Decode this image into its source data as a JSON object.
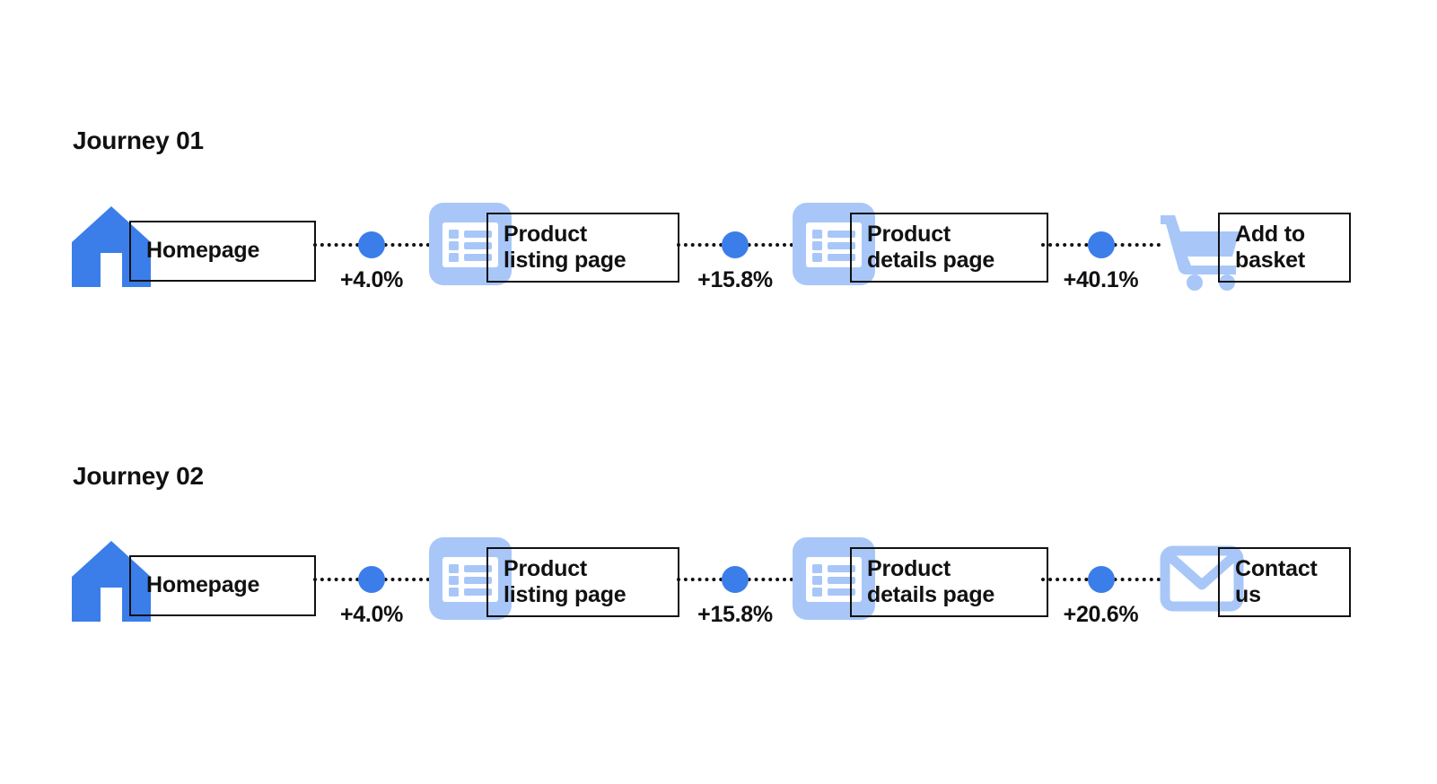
{
  "colors": {
    "icon_primary": "#3B7EEA",
    "icon_secondary": "#A8C7F8",
    "dot": "#3B7EEA",
    "text": "#111111",
    "background": "#FFFFFF",
    "box_border": "#111111"
  },
  "journeys": [
    {
      "title": "Journey 01",
      "steps": [
        {
          "label": "Homepage",
          "icon": "home-icon"
        },
        {
          "label": "Product\nlisting page",
          "icon": "list-page-icon"
        },
        {
          "label": "Product\ndetails page",
          "icon": "list-page-icon"
        },
        {
          "label": "Add to\nbasket",
          "icon": "shopping-cart-icon"
        }
      ],
      "connectors": [
        {
          "percent": "+4.0%"
        },
        {
          "percent": "+15.8%"
        },
        {
          "percent": "+40.1%"
        }
      ]
    },
    {
      "title": "Journey 02",
      "steps": [
        {
          "label": "Homepage",
          "icon": "home-icon"
        },
        {
          "label": "Product\nlisting page",
          "icon": "list-page-icon"
        },
        {
          "label": "Product\ndetails page",
          "icon": "list-page-icon"
        },
        {
          "label": "Contact\nus",
          "icon": "envelope-icon"
        }
      ],
      "connectors": [
        {
          "percent": "+4.0%"
        },
        {
          "percent": "+15.8%"
        },
        {
          "percent": "+20.6%"
        }
      ]
    }
  ]
}
